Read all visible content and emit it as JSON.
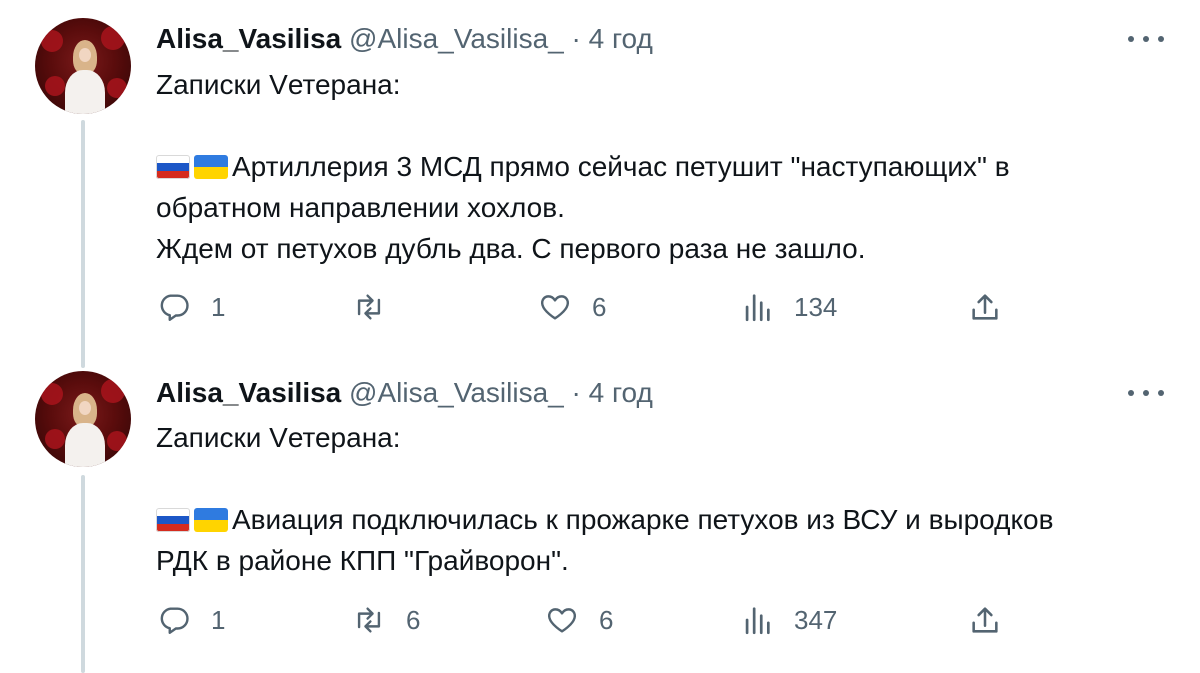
{
  "tweets": [
    {
      "author": {
        "name": "Alisa_Vasilisa",
        "handle": "@Alisa_Vasilisa_",
        "separator": "·",
        "time": "4 год"
      },
      "lines": [
        "Zаписки Vетерана:",
        "",
        "Артиллерия 3 МСД прямо сейчас петушит \"наступающих\" в",
        "обратном направлении хохлов.",
        "Ждем от петухов дубль два. С первого раза не зашло."
      ],
      "stats": {
        "replies": "1",
        "retweets": "",
        "likes": "6",
        "views": "134"
      }
    },
    {
      "author": {
        "name": "Alisa_Vasilisa",
        "handle": "@Alisa_Vasilisa_",
        "separator": "·",
        "time": "4 год"
      },
      "lines": [
        "Zаписки Vетерана:",
        "",
        "Авиация подключилась к прожарке петухов из ВСУ и выродков",
        "РДК в районе КПП \"Грайворон\"."
      ],
      "stats": {
        "replies": "1",
        "retweets": "6",
        "likes": "6",
        "views": "347"
      }
    }
  ],
  "icons": {
    "reply": "reply-icon",
    "retweet": "retweet-icon",
    "like": "heart-icon",
    "views": "views-icon",
    "share": "share-icon",
    "more": "more-icon",
    "flags": [
      "flag-russia-icon",
      "flag-ukraine-icon"
    ]
  },
  "colors": {
    "text": "#0f1419",
    "secondary": "#536471",
    "thread_line": "#cfd9de"
  }
}
